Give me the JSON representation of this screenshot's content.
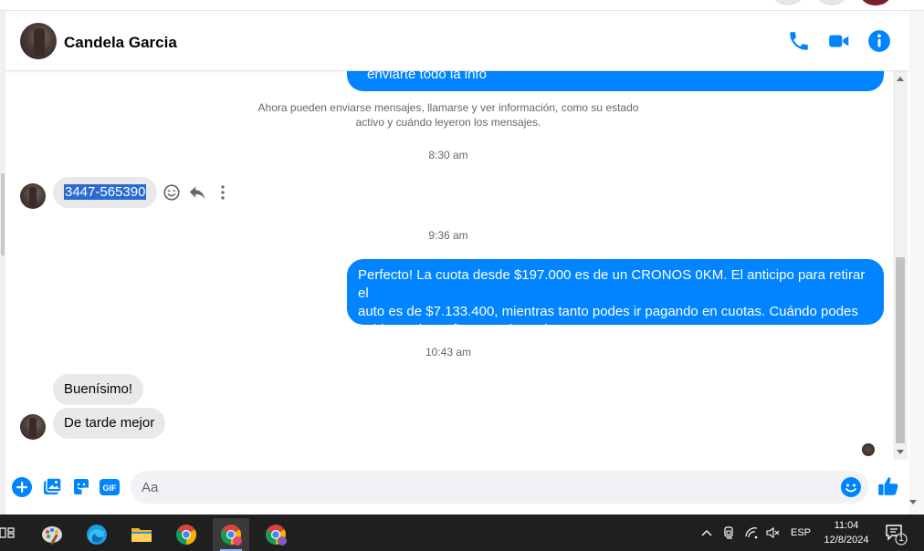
{
  "header": {
    "contact_name": "Candela Garcia"
  },
  "messages": {
    "partial_top_bubble": "enviarte todo la info",
    "system_note_line1": "Ahora pueden enviarse mensajes, llamarse y ver información, como su estado",
    "system_note_line2": "activo y cuándo leyeron los mensajes.",
    "time_1": "8:30 am",
    "incoming_number": "3447-565390",
    "time_2": "9:36 am",
    "outgoing_main_line1": "Perfecto! La cuota desde $197.000 es de un CRONOS 0KM. El anticipo para retirar el",
    "outgoing_main_line2": "auto es de $7.133.400, mientras tanto podes ir pagando en cuotas. Cuándo podes",
    "outgoing_main_line3": "hablar? A la mañana o a la tarde?",
    "time_3": "10:43 am",
    "incoming_1": "Buenísimo!",
    "incoming_2": "De tarde mejor"
  },
  "composer": {
    "placeholder": "Aa"
  },
  "taskbar": {
    "language": "ESP",
    "time": "11:04",
    "date": "12/8/2024",
    "notification_count": "1"
  },
  "colors": {
    "messenger_blue": "#0084ff",
    "incoming_bubble": "#e9e9eb",
    "taskbar_bg": "#1f1f1f"
  },
  "icons": {
    "header": [
      "phone-icon",
      "video-camera-icon",
      "info-icon"
    ],
    "composer": [
      "plus-icon",
      "photo-icon",
      "sticker-icon",
      "gif-icon",
      "emoji-icon",
      "thumbs-up-icon"
    ],
    "message_actions": [
      "react-smiley-icon",
      "reply-icon",
      "more-icon"
    ]
  }
}
